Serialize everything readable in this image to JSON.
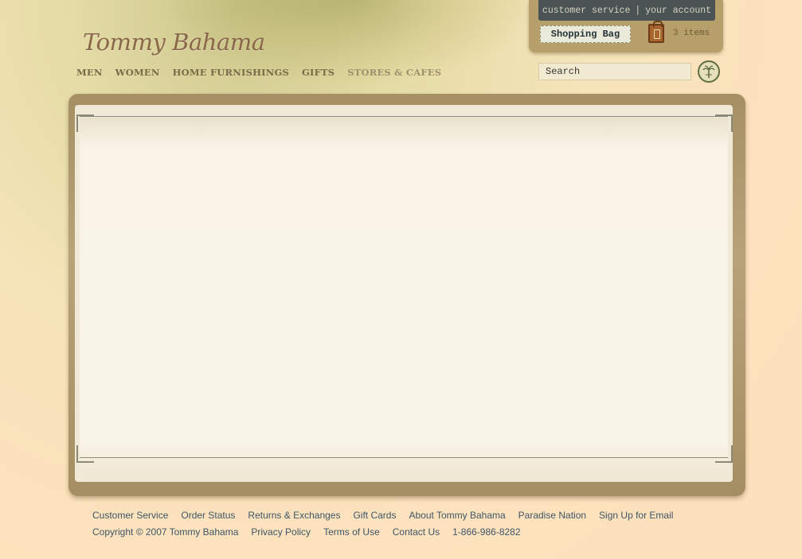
{
  "brand": {
    "logo_text": "Tommy Bahama"
  },
  "account": {
    "customer_service": "customer service",
    "separator": "|",
    "your_account": "your account"
  },
  "bag": {
    "label": "Shopping Bag",
    "items_text": "3 items"
  },
  "nav": {
    "items": [
      {
        "label": "MEN"
      },
      {
        "label": "WOMEN"
      },
      {
        "label": "HOME FURNISHINGS"
      },
      {
        "label": "GIFTS"
      },
      {
        "label": "STORES & CAFES"
      }
    ]
  },
  "search": {
    "value": "Search"
  },
  "footer": {
    "row1": [
      "Customer Service",
      "Order Status",
      "Returns & Exchanges",
      "Gift Cards",
      "About Tommy Bahama",
      "Paradise Nation",
      "Sign Up for Email"
    ],
    "copyright": "Copyright © 2007 Tommy Bahama",
    "row2": [
      "Privacy Policy",
      "Terms of Use",
      "Contact Us",
      "1-866-986-8282"
    ]
  },
  "colors": {
    "accent": "#7b6a48",
    "footer_link": "#3e5668",
    "account_bar": "#4a5454"
  }
}
